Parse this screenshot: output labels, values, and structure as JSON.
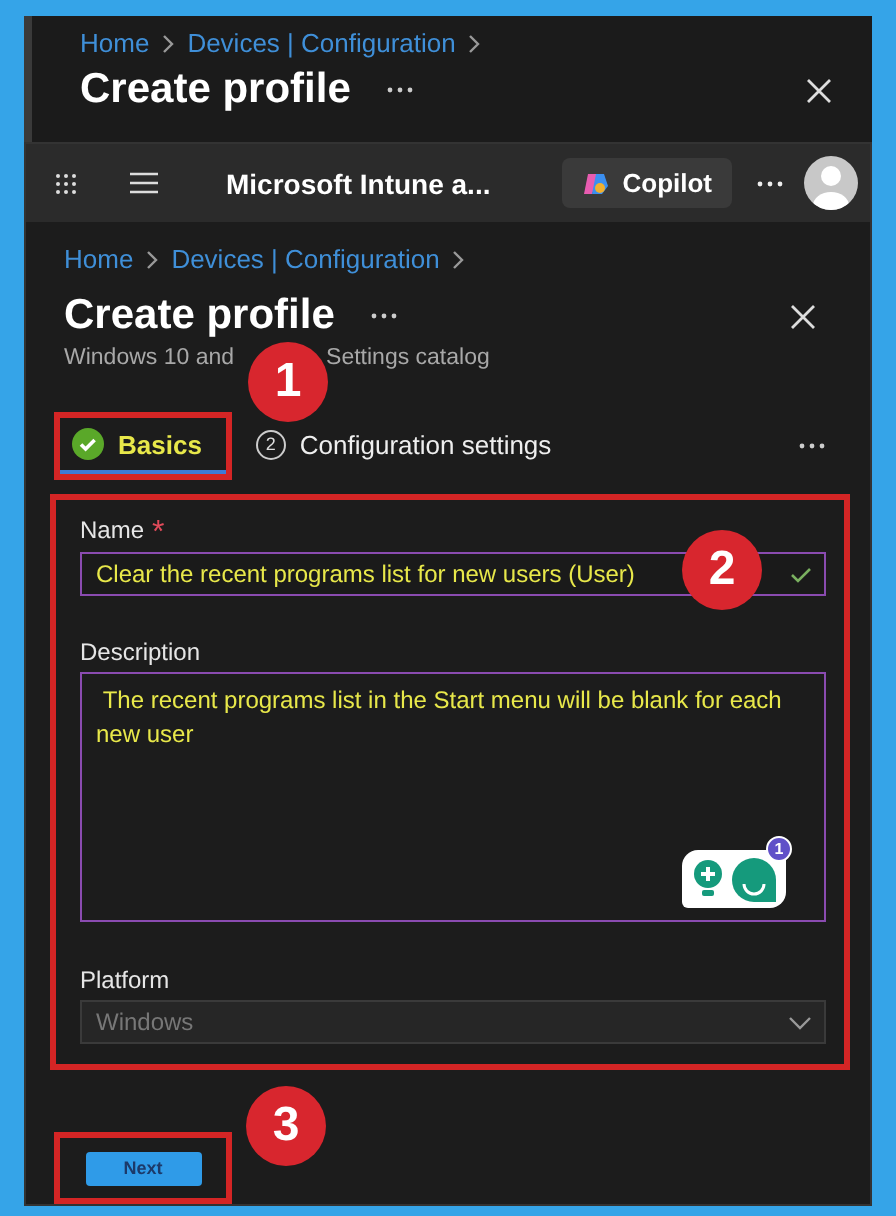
{
  "background_window": {
    "breadcrumb": [
      "Home",
      "Devices | Configuration"
    ],
    "title": "Create profile"
  },
  "top_bar": {
    "app_title": "Microsoft Intune a...",
    "copilot_label": "Copilot"
  },
  "breadcrumb": [
    "Home",
    "Devices | Configuration"
  ],
  "title": "Create profile",
  "subtitle_parts": [
    "Windows 10 and",
    "Settings catalog"
  ],
  "tabs": [
    {
      "label": "Basics",
      "selected": true,
      "kind": "done"
    },
    {
      "label": "Configuration settings",
      "selected": false,
      "kind": "step",
      "number": "2"
    }
  ],
  "form": {
    "name": {
      "label": "Name",
      "required_mark": "*",
      "value": "Clear the recent programs list for new users (User)",
      "valid": true
    },
    "description": {
      "label": "Description",
      "value": " The recent programs list in the Start menu will be blank for each new user",
      "assistant_count": "1"
    },
    "platform": {
      "label": "Platform",
      "value": "Windows",
      "disabled": true
    }
  },
  "next_button": "Next",
  "annotations": [
    {
      "number": "1"
    },
    {
      "number": "2"
    },
    {
      "number": "3"
    }
  ]
}
